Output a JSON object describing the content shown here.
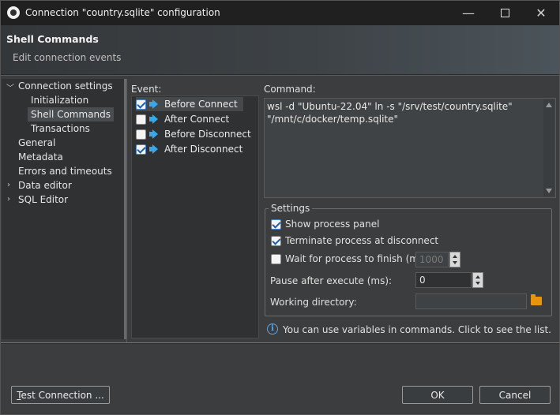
{
  "window": {
    "title": "Connection \"country.sqlite\" configuration",
    "controls": {
      "minimize": "—",
      "close": "✕"
    }
  },
  "header": {
    "title": "Shell Commands",
    "subtitle": "Edit connection events"
  },
  "tree": {
    "items": [
      {
        "label": "Connection settings",
        "expanded": true
      },
      {
        "label": "Initialization"
      },
      {
        "label": "Shell Commands",
        "selected": true
      },
      {
        "label": "Transactions"
      },
      {
        "label": "General"
      },
      {
        "label": "Metadata"
      },
      {
        "label": "Errors and timeouts"
      },
      {
        "label": "Data editor",
        "expanded": false
      },
      {
        "label": "SQL Editor",
        "expanded": false
      }
    ]
  },
  "events": {
    "label": "Event:",
    "items": [
      {
        "label": "Before Connect",
        "checked": true,
        "selected": true
      },
      {
        "label": "After Connect",
        "checked": false
      },
      {
        "label": "Before Disconnect",
        "checked": false
      },
      {
        "label": "After Disconnect",
        "checked": true
      }
    ]
  },
  "command": {
    "label": "Command:",
    "value": "wsl -d \"Ubuntu-22.04\" ln -s \"/srv/test/country.sqlite\"\n\"/mnt/c/docker/temp.sqlite\""
  },
  "settings": {
    "legend": "Settings",
    "show_process_panel": {
      "label": "Show process panel",
      "checked": true
    },
    "terminate_on_disconnect": {
      "label": "Terminate process at disconnect",
      "checked": true
    },
    "wait_for_finish": {
      "label": "Wait for process to finish (ms)",
      "checked": false,
      "value": "1000"
    },
    "pause_after_execute": {
      "label": "Pause after execute (ms):",
      "value": "0"
    },
    "working_directory": {
      "label": "Working directory:",
      "value": ""
    }
  },
  "info": {
    "text": "You can use variables in commands. Click to see the list."
  },
  "buttons": {
    "test_connection": "Test Connection ...",
    "ok": "OK",
    "cancel": "Cancel"
  },
  "colors": {
    "accent": "#3ba7e8",
    "background": "#3b3d3f",
    "panel": "#2f3133",
    "folder": "#e8940c"
  },
  "icons": {
    "app": "dbeaver-icon",
    "event": "megaphone-icon",
    "info": "info-icon",
    "folder": "folder-icon"
  }
}
